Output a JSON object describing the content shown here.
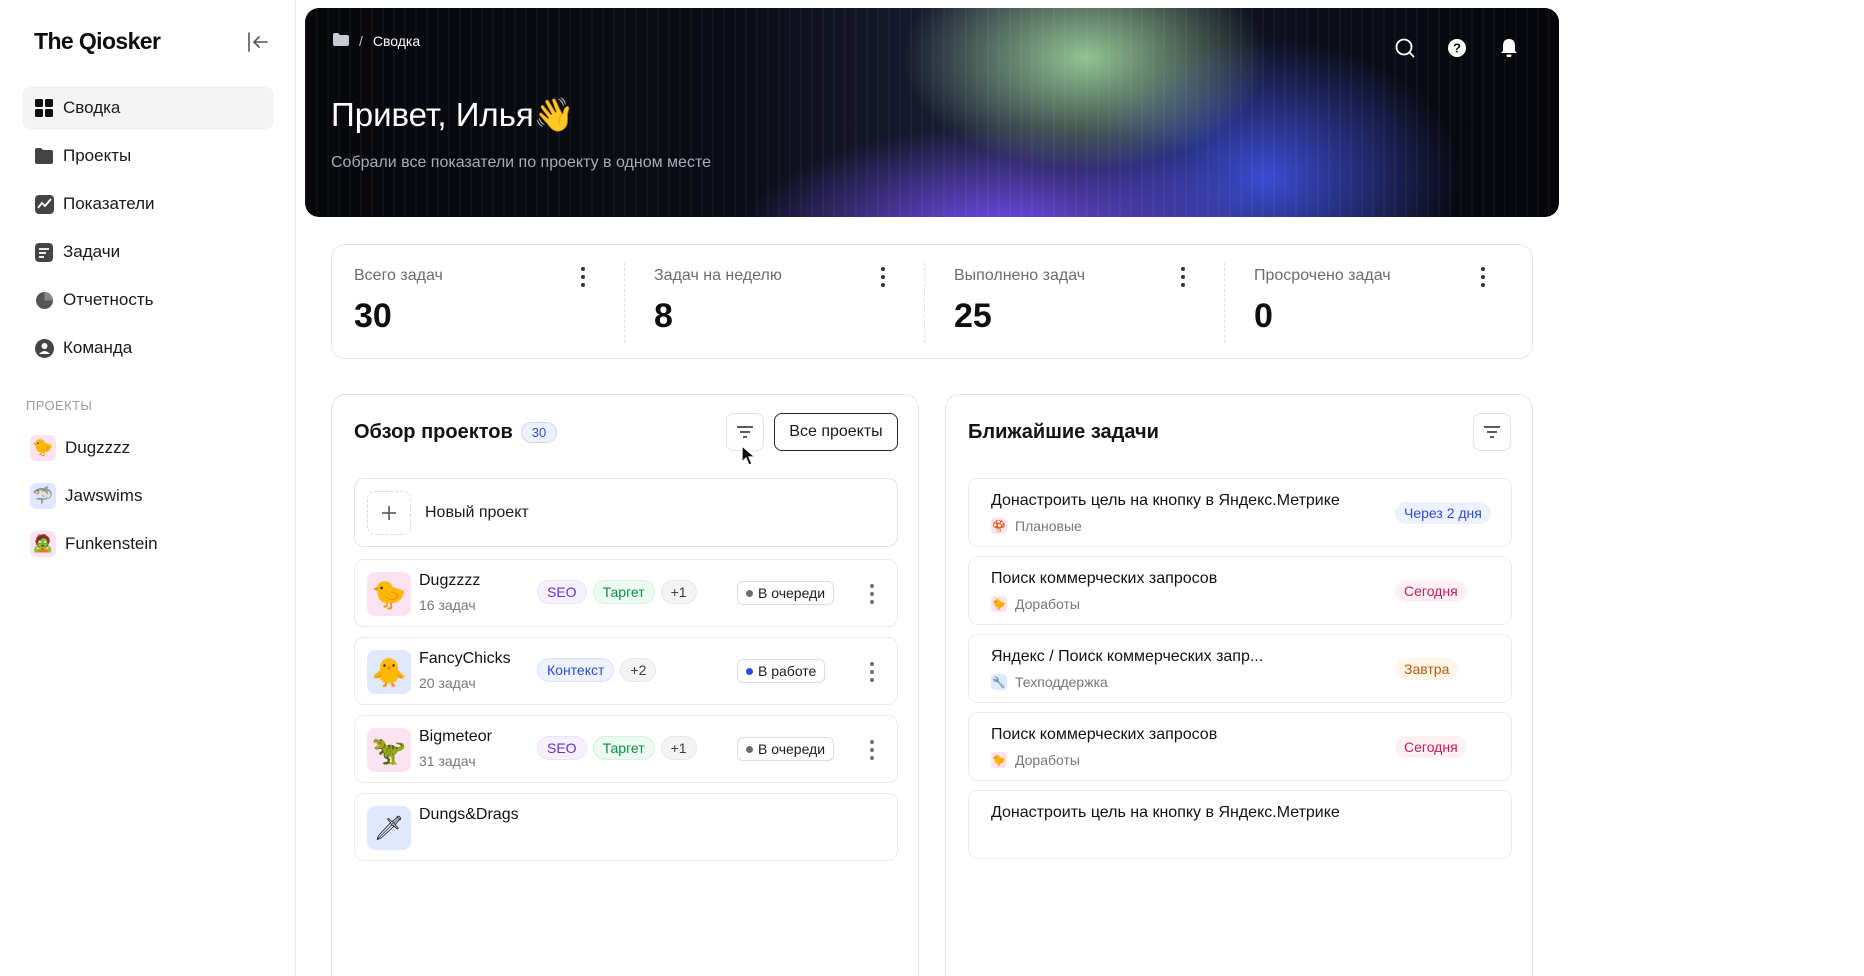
{
  "sidebar": {
    "logo": "The Qiosker",
    "nav": [
      {
        "label": "Сводка",
        "icon": "grid-icon"
      },
      {
        "label": "Проекты",
        "icon": "folder-icon"
      },
      {
        "label": "Показатели",
        "icon": "chart-icon"
      },
      {
        "label": "Задачи",
        "icon": "tasks-icon"
      },
      {
        "label": "Отчетность",
        "icon": "pie-icon"
      },
      {
        "label": "Команда",
        "icon": "team-icon"
      }
    ],
    "projects_label": "ПРОЕКТЫ",
    "projects": [
      {
        "name": "Dugzzzz",
        "emoji": "🐤"
      },
      {
        "name": "Jawswims",
        "emoji": "🦈"
      },
      {
        "name": "Funkenstein",
        "emoji": "🧟"
      }
    ]
  },
  "hero": {
    "breadcrumb": "Сводка",
    "breadcrumb_sep": "/",
    "title": "Привет, Илья👋",
    "subtitle": "Собрали все показатели по проекту в одном месте"
  },
  "stats": [
    {
      "label": "Всего задач",
      "value": "30"
    },
    {
      "label": "Задач на неделю",
      "value": "8"
    },
    {
      "label": "Выполнено задач",
      "value": "25"
    },
    {
      "label": "Просрочено задач",
      "value": "0"
    }
  ],
  "projects_panel": {
    "title": "Обзор проектов",
    "count": "30",
    "all_button": "Все проекты",
    "new_project": "Новый проект",
    "rows": [
      {
        "name": "Dugzzzz",
        "tasks": "16 задач",
        "emoji": "🐤",
        "avatar_bg": "#fde3f1",
        "tags": [
          "SEO",
          "Таргет",
          "+1"
        ],
        "status": "В очереди",
        "status_color": "#6b6b73"
      },
      {
        "name": "FancyChicks",
        "tasks": "20 задач",
        "emoji": "🐥",
        "avatar_bg": "#dfe8ff",
        "tags": [
          "Контекст",
          "+2"
        ],
        "status": "В работе",
        "status_color": "#2b4dd8"
      },
      {
        "name": "Bigmeteor",
        "tasks": "31 задач",
        "emoji": "🦖",
        "avatar_bg": "#fde3f1",
        "tags": [
          "SEO",
          "Таргет",
          "+1"
        ],
        "status": "В очереди",
        "status_color": "#6b6b73"
      },
      {
        "name": "Dungs&Drags",
        "tasks": "",
        "emoji": "🗡",
        "avatar_bg": "#dfe8ff",
        "tags": [],
        "status": "",
        "status_color": "#6b6b73"
      }
    ]
  },
  "tasks_panel": {
    "title": "Ближайшие задачи",
    "rows": [
      {
        "title": "Донастроить цель на кнопку в Яндекс.Метрике",
        "category": "Плановые",
        "cat_emoji": "🍄",
        "cat_bg": "#ffe3e8",
        "due": "Через 2 дня",
        "due_style": "blue"
      },
      {
        "title": "Поиск коммерческих запросов",
        "category": "Доработы",
        "cat_emoji": "🐤",
        "cat_bg": "#fde3f1",
        "due": "Сегодня",
        "due_style": "pink"
      },
      {
        "title": "Яндекс / Поиск коммерческих запр...",
        "category": "Техподдержка",
        "cat_emoji": "🔧",
        "cat_bg": "#dfe8ff",
        "due": "Завтра",
        "due_style": "orange"
      },
      {
        "title": "Поиск коммерческих запросов",
        "category": "Доработы",
        "cat_emoji": "🐤",
        "cat_bg": "#fde3f1",
        "due": "Сегодня",
        "due_style": "pink"
      },
      {
        "title": "Донастроить цель на кнопку в Яндекс.Метрике",
        "category": "",
        "cat_emoji": "",
        "cat_bg": "#ffffff",
        "due": "",
        "due_style": "blue"
      }
    ]
  },
  "colors": {
    "accent": "#2b4dd8",
    "seo": "#6b2fd6",
    "target": "#118a4a",
    "pink": "#c81d5a",
    "orange": "#c45a0a"
  }
}
